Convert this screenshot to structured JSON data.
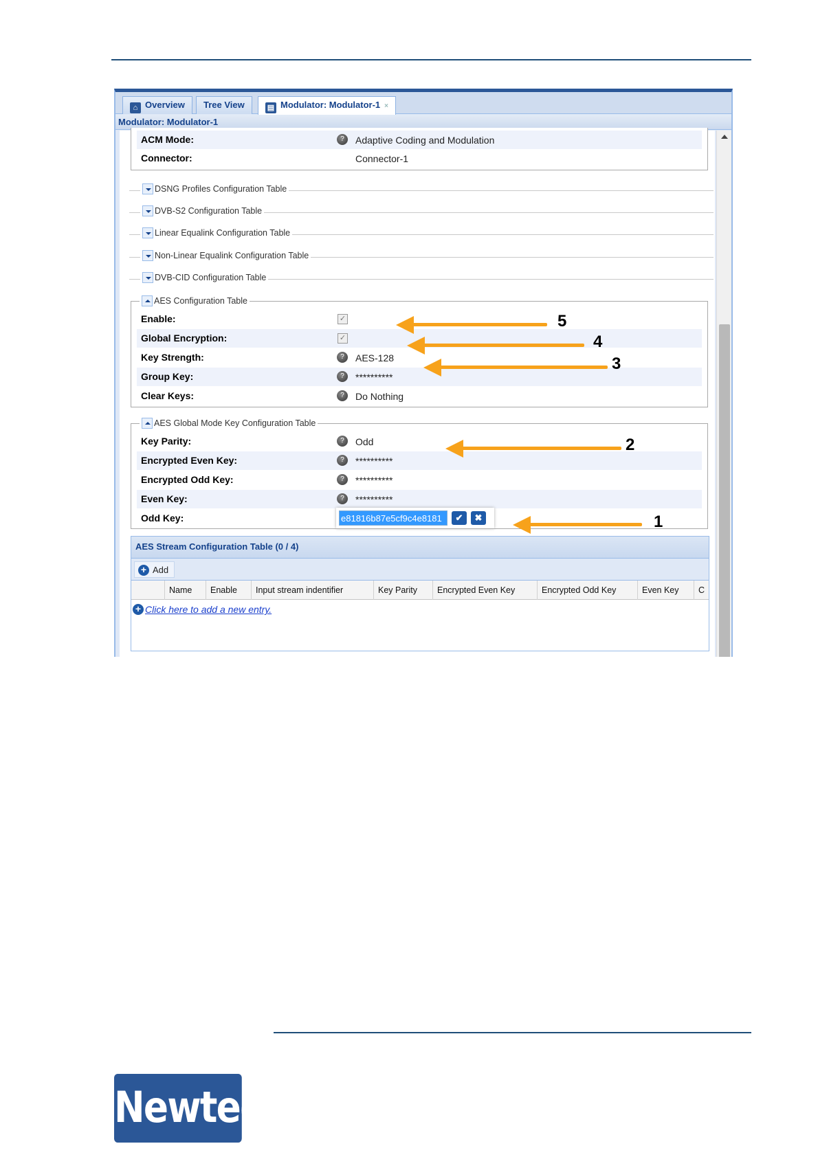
{
  "tabs": [
    {
      "label": "Overview",
      "icon": "home-icon"
    },
    {
      "label": "Tree View"
    },
    {
      "label": "Modulator: Modulator-1",
      "icon": "document-icon",
      "close": "×"
    }
  ],
  "panel_title": "Modulator: Modulator-1",
  "top_fields": [
    {
      "label": "ACM Mode:",
      "value": "Adaptive Coding and Modulation"
    },
    {
      "label": "Connector:",
      "value": "Connector-1"
    }
  ],
  "collapsed_sections": [
    "DSNG Profiles Configuration Table",
    "DVB-S2 Configuration Table",
    "Linear Equalink Configuration Table",
    "Non-Linear Equalink Configuration Table",
    "DVB-CID Configuration Table"
  ],
  "aes_config": {
    "title": "AES Configuration Table",
    "rows": [
      {
        "label": "Enable:",
        "checked": "✓"
      },
      {
        "label": "Global Encryption:",
        "checked": "✓"
      },
      {
        "label": "Key Strength:",
        "value": "AES-128"
      },
      {
        "label": "Group Key:",
        "value": "**********"
      },
      {
        "label": "Clear Keys:",
        "value": "Do Nothing"
      }
    ]
  },
  "aes_global": {
    "title": "AES Global Mode Key Configuration Table",
    "rows": [
      {
        "label": "Key Parity:",
        "value": "Odd"
      },
      {
        "label": "Encrypted Even Key:",
        "value": "**********"
      },
      {
        "label": "Encrypted Odd Key:",
        "value": "**********"
      },
      {
        "label": "Even Key:",
        "value": "**********"
      },
      {
        "label": "Odd Key:",
        "value": "e81816b87e5cf9c4e8181"
      }
    ],
    "confirm_glyph": "✔",
    "cancel_glyph": "✖"
  },
  "stream_table": {
    "title": "AES Stream Configuration Table (0 / 4)",
    "add_label": "Add",
    "columns": [
      "Name",
      "Enable",
      "Input stream indentifier",
      "Key Parity",
      "Encrypted Even Key",
      "Encrypted Odd Key",
      "Even Key",
      "C"
    ],
    "new_entry": "Click here to add a new entry."
  },
  "annotations": [
    "5",
    "4",
    "3",
    "2",
    "1"
  ],
  "accent_color": "#f7a21b",
  "brand_color": "#2b5797",
  "logo_text": "Newtec"
}
